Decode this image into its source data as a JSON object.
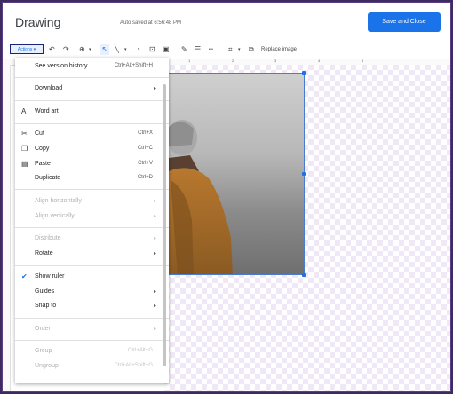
{
  "header": {
    "title": "Drawing",
    "autosave": "Auto saved at 6:56:48 PM",
    "save_button": "Save and Close"
  },
  "toolbar": {
    "actions": "Actions ▾",
    "replace_image": "Replace image"
  },
  "ruler_ticks": [
    "1",
    "2",
    "3",
    "4",
    "5"
  ],
  "menu": {
    "version_history": {
      "label": "See version history",
      "shortcut": "Ctrl+Alt+Shift+H"
    },
    "download": {
      "label": "Download",
      "arrow": "▸"
    },
    "word_art": {
      "label": "Word art"
    },
    "cut": {
      "label": "Cut",
      "shortcut": "Ctrl+X"
    },
    "copy": {
      "label": "Copy",
      "shortcut": "Ctrl+C"
    },
    "paste": {
      "label": "Paste",
      "shortcut": "Ctrl+V"
    },
    "duplicate": {
      "label": "Duplicate",
      "shortcut": "Ctrl+D"
    },
    "align_horizontally": {
      "label": "Align horizontally",
      "arrow": "▸"
    },
    "align_vertically": {
      "label": "Align vertically",
      "arrow": "▸"
    },
    "distribute": {
      "label": "Distribute",
      "arrow": "▸"
    },
    "rotate": {
      "label": "Rotate",
      "arrow": "▸"
    },
    "show_ruler": {
      "label": "Show ruler"
    },
    "guides": {
      "label": "Guides",
      "arrow": "▸"
    },
    "snap_to": {
      "label": "Snap to",
      "arrow": "▸"
    },
    "order": {
      "label": "Order",
      "arrow": "▸"
    },
    "group": {
      "label": "Group",
      "shortcut": "Ctrl+Alt+G"
    },
    "ungroup": {
      "label": "Ungroup",
      "shortcut": "Ctrl+Alt+Shift+G"
    }
  },
  "colors": {
    "accent": "#1a73e8",
    "frame": "#3d2a5e"
  },
  "icons": [
    "undo-icon",
    "redo-icon",
    "zoom-icon",
    "select-icon",
    "line-icon",
    "shape-icon",
    "textbox-icon",
    "image-icon",
    "pen-icon",
    "border-weight-icon",
    "border-dash-icon",
    "crop-icon",
    "replace-image-icon",
    "cut-icon",
    "copy-icon",
    "paste-icon",
    "word-art-icon",
    "check-icon"
  ]
}
